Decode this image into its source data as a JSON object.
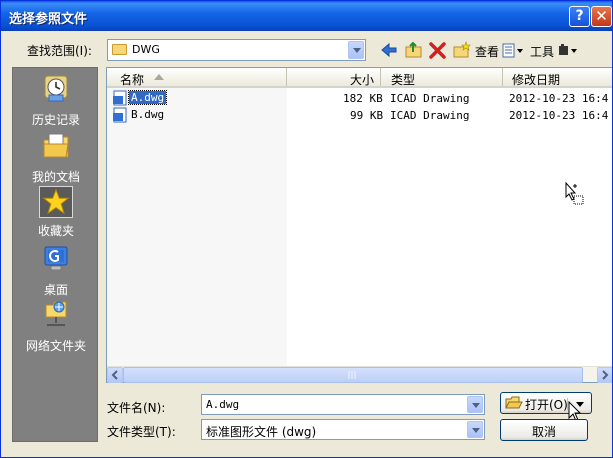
{
  "window": {
    "title": "选择参照文件"
  },
  "toolbar": {
    "lookin_label": "查找范围(I):",
    "lookin_value": "DWG",
    "view_label": "查看",
    "tools_label": "工具"
  },
  "places": [
    {
      "label": "历史记录"
    },
    {
      "label": "我的文档"
    },
    {
      "label": "收藏夹"
    },
    {
      "label": "桌面"
    },
    {
      "label": "网络文件夹"
    }
  ],
  "columns": {
    "name": "名称",
    "size": "大小",
    "type": "类型",
    "modified": "修改日期"
  },
  "files": [
    {
      "name": "A.dwg",
      "size": "182 KB",
      "type": "ICAD Drawing",
      "modified": "2012-10-23 16:4"
    },
    {
      "name": "B.dwg",
      "size": "99 KB",
      "type": "ICAD Drawing",
      "modified": "2012-10-23 16:4"
    }
  ],
  "filename": {
    "label": "文件名(N):",
    "value": "A.dwg"
  },
  "filetype": {
    "label": "文件类型(T):",
    "value": "标准图形文件 (dwg)"
  },
  "buttons": {
    "open": "打开(O)",
    "cancel": "取消"
  },
  "colors": {
    "titlebar": "#0a5ae8",
    "selection": "#316ac5",
    "places_bg": "#808080"
  }
}
